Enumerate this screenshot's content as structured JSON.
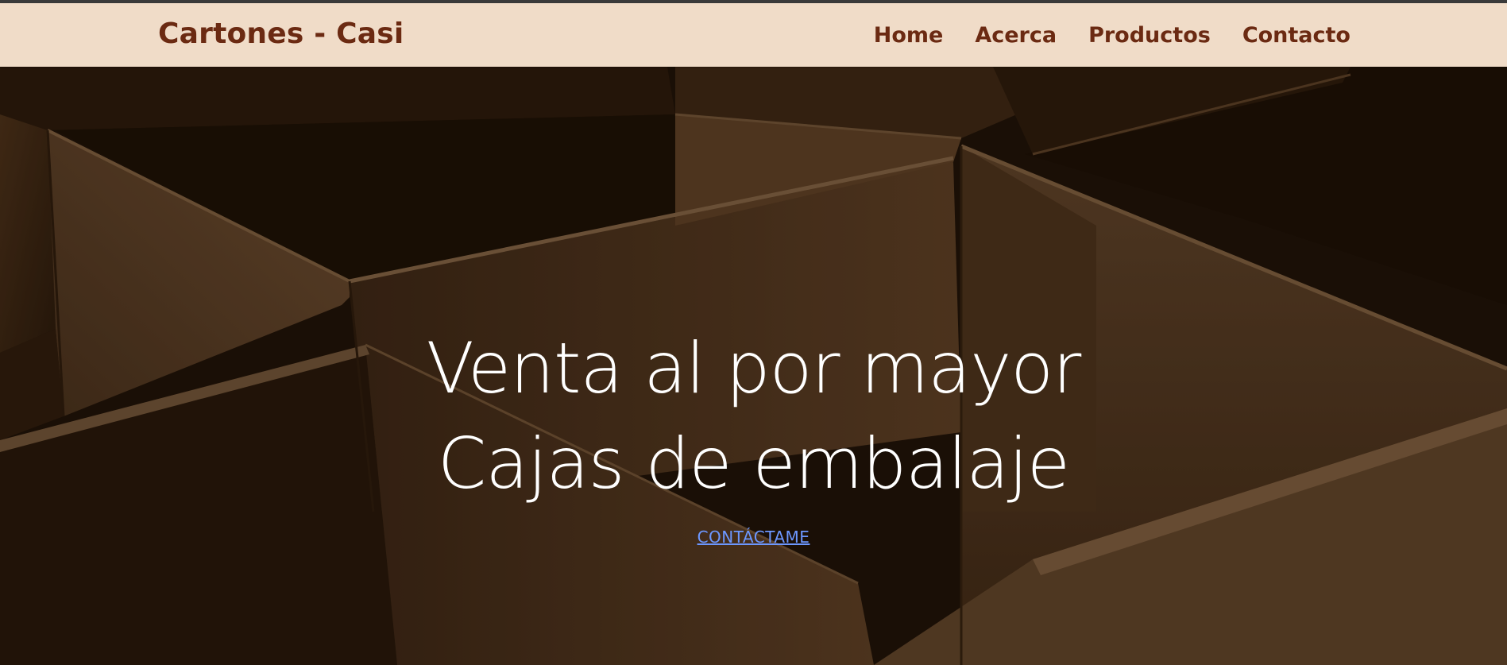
{
  "header": {
    "brand": "Cartones - Casi",
    "nav": [
      {
        "label": "Home"
      },
      {
        "label": "Acerca"
      },
      {
        "label": "Productos"
      },
      {
        "label": "Contacto"
      }
    ]
  },
  "hero": {
    "title_line1": "Venta al por mayor",
    "title_line2": "Cajas de embalaje",
    "cta_label": "CONTÁCTAME"
  },
  "colors": {
    "navbar_bg": "#f0dcc8",
    "brand_text": "#6b2a12",
    "hero_text": "#ffffff",
    "cta_link": "#6c97ff"
  }
}
